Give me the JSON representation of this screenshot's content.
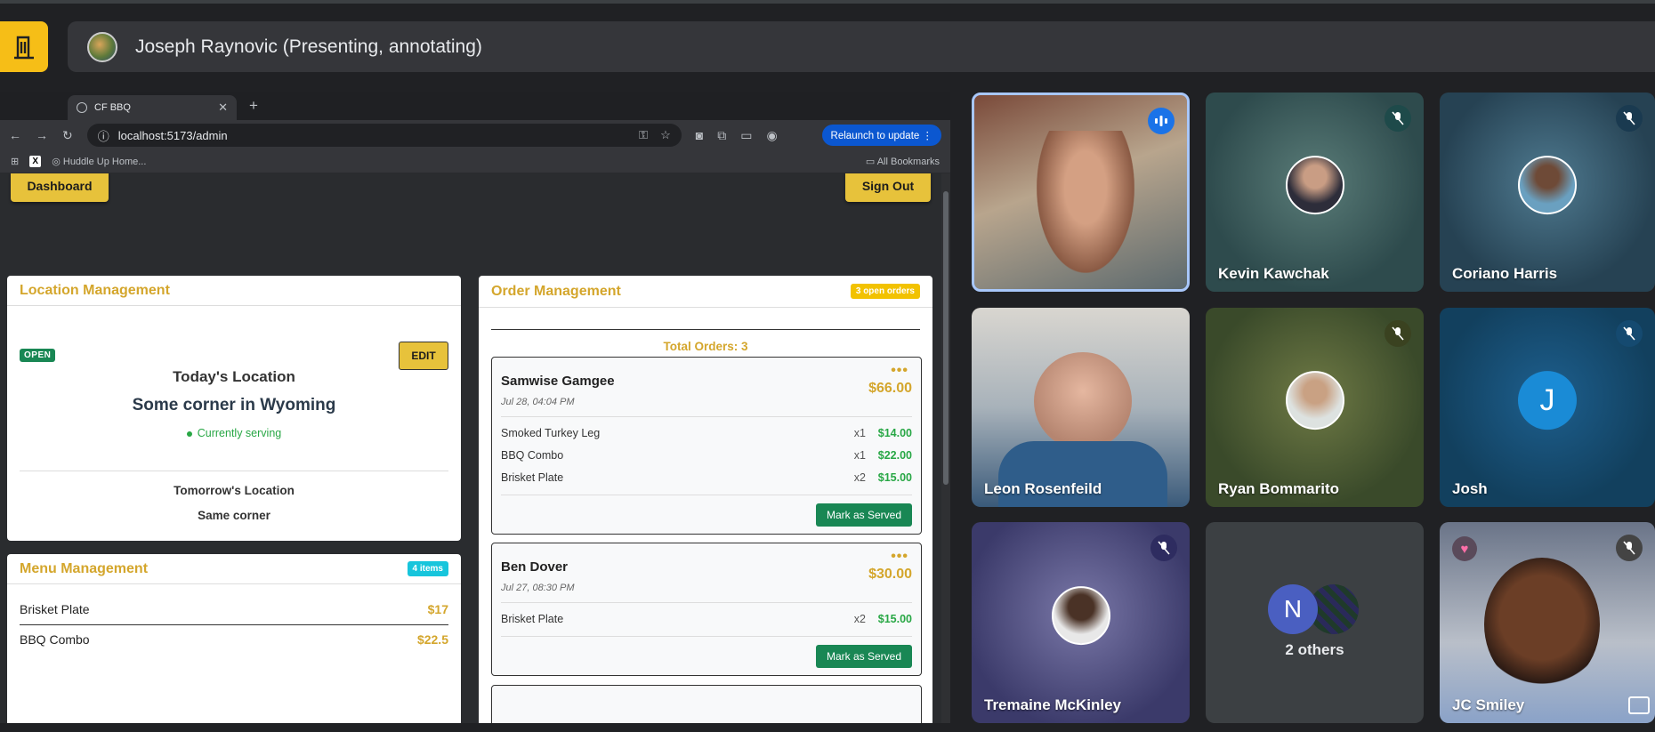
{
  "meet": {
    "presenter_label": "Joseph Raynovic (Presenting, annotating)",
    "participants": [
      {
        "name": "",
        "muted": false,
        "speaking": true
      },
      {
        "name": "Kevin Kawchak",
        "muted": true
      },
      {
        "name": "Coriano Harris",
        "muted": true
      },
      {
        "name": "Leon Rosenfeild",
        "muted": false
      },
      {
        "name": "Ryan Bommarito",
        "muted": true
      },
      {
        "name": "Josh",
        "muted": true,
        "initial": "J"
      },
      {
        "name": "Tremaine McKinley",
        "muted": true
      },
      {
        "name": "2 others",
        "initial": "N"
      },
      {
        "name": "JC Smiley",
        "muted": true
      }
    ]
  },
  "browser": {
    "tab_title": "CF BBQ",
    "url": "localhost:5173/admin",
    "relaunch_label": "Relaunch to update",
    "bookmark": "Huddle Up Home...",
    "all_bookmarks": "All Bookmarks"
  },
  "admin": {
    "dashboard_label": "Dashboard",
    "signout_label": "Sign Out",
    "location": {
      "header": "Location Management",
      "status": "OPEN",
      "edit_label": "EDIT",
      "today_title": "Today's Location",
      "today_value": "Some corner in Wyoming",
      "serving_status": "Currently serving",
      "tomorrow_title": "Tomorrow's Location",
      "tomorrow_value": "Same corner"
    },
    "menu": {
      "header": "Menu Management",
      "badge": "4 items",
      "items": [
        {
          "name": "Brisket Plate",
          "price": "$17"
        },
        {
          "name": "BBQ Combo",
          "price": "$22.5"
        }
      ]
    },
    "orders": {
      "header": "Order Management",
      "badge": "3 open orders",
      "total_label": "Total Orders: 3",
      "mark_served_label": "Mark as Served",
      "list": [
        {
          "customer": "Samwise Gamgee",
          "date": "Jul 28, 04:04 PM",
          "total": "$66.00",
          "items": [
            {
              "name": "Smoked Turkey Leg",
              "qty": "x1",
              "price": "$14.00"
            },
            {
              "name": "BBQ Combo",
              "qty": "x1",
              "price": "$22.00"
            },
            {
              "name": "Brisket Plate",
              "qty": "x2",
              "price": "$15.00"
            }
          ]
        },
        {
          "customer": "Ben Dover",
          "date": "Jul 27, 08:30 PM",
          "total": "$30.00",
          "items": [
            {
              "name": "Brisket Plate",
              "qty": "x2",
              "price": "$15.00"
            }
          ]
        }
      ]
    }
  },
  "colors": {
    "meet_bg": "#202124",
    "accent_yellow": "#f6be17",
    "gold": "#d4a62c",
    "green": "#198754"
  }
}
